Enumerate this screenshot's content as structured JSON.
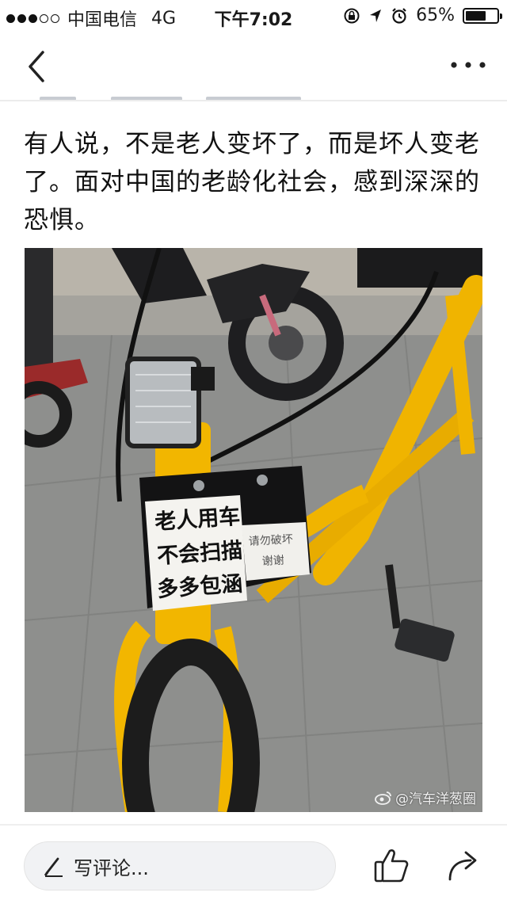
{
  "status_bar": {
    "carrier": "中国电信",
    "network": "4G",
    "time": "下午7:02",
    "battery": "65%",
    "battery_level": 0.65
  },
  "post": {
    "text": "有人说，不是老人变坏了，而是坏人变老了。面对中国的老龄化社会，感到深深的恐惧。"
  },
  "image": {
    "sign_lines": [
      "老人用车",
      "不会扫描",
      "多多包涵"
    ],
    "sign_side_lines": [
      "请勿破坏",
      "谢谢"
    ],
    "watermark": "@汽车洋葱圈"
  },
  "bottom_bar": {
    "comment_placeholder": "写评论..."
  },
  "colors": {
    "bike_yellow": "#f0b400",
    "pavement": "#8e8f8d"
  },
  "icons": [
    "back-chevron-icon",
    "more-dots-icon",
    "pencil-icon",
    "thumbs-up-icon",
    "share-arrow-icon",
    "weibo-icon"
  ]
}
